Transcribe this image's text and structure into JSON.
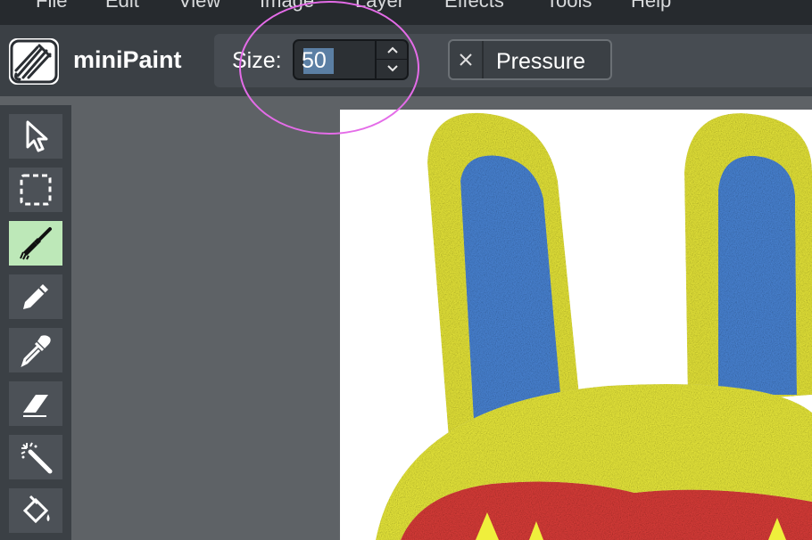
{
  "menu": {
    "items": [
      {
        "label": "File"
      },
      {
        "label": "Edit"
      },
      {
        "label": "View"
      },
      {
        "label": "Image"
      },
      {
        "label": "Layer"
      },
      {
        "label": "Effects"
      },
      {
        "label": "Tools"
      },
      {
        "label": "Help"
      }
    ]
  },
  "app": {
    "name": "miniPaint"
  },
  "attributes": {
    "size_label": "Size:",
    "size_value": "50",
    "pressure_label": "Pressure"
  },
  "tools": [
    {
      "icon": "select-arrow-icon",
      "active": false
    },
    {
      "icon": "selection-rect-icon",
      "active": false
    },
    {
      "icon": "brush-icon",
      "active": true
    },
    {
      "icon": "pencil-icon",
      "active": false
    },
    {
      "icon": "eyedropper-icon",
      "active": false
    },
    {
      "icon": "eraser-icon",
      "active": false
    },
    {
      "icon": "magic-wand-icon",
      "active": false
    },
    {
      "icon": "fill-bucket-icon",
      "active": false
    }
  ],
  "colors": {
    "menubar_bg": "#262a2e",
    "toolbar_bg": "#3b4045",
    "active_tool": "#bde8b8",
    "annotation": "#e46ce8",
    "bunny_yellow": "#f0ee3c",
    "bunny_blue": "#4a86d8",
    "bunny_red": "#e04040"
  }
}
